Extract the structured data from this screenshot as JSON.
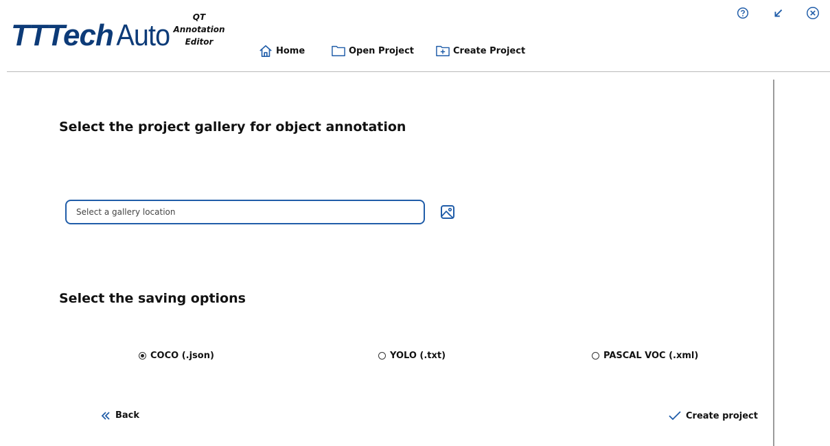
{
  "app": {
    "logo_text_bold": "TTTech",
    "logo_text_light": "Auto",
    "subtitle_line1": "QT",
    "subtitle_line2": "Annotation",
    "subtitle_line3": "Editor"
  },
  "nav": {
    "home_label": "Home",
    "open_label": "Open Project",
    "create_label": "Create Project"
  },
  "window_controls": {
    "help_icon": "help-circle-icon",
    "minimize_icon": "arrow-down-left-icon",
    "close_icon": "close-circle-icon"
  },
  "gallery": {
    "title": "Select the project gallery for object annotation",
    "input_value": "",
    "input_placeholder": "Select a gallery location",
    "browse_icon": "image-icon"
  },
  "saving": {
    "title": "Select the saving options",
    "options": [
      {
        "label": "COCO (.json)",
        "selected": true
      },
      {
        "label": "YOLO (.txt)",
        "selected": false
      },
      {
        "label": "PASCAL VOC (.xml)",
        "selected": false
      }
    ]
  },
  "actions": {
    "back_label": "Back",
    "create_label": "Create project"
  },
  "colors": {
    "brand_blue": "#0d3b78",
    "accent_blue": "#1f5ca8"
  }
}
